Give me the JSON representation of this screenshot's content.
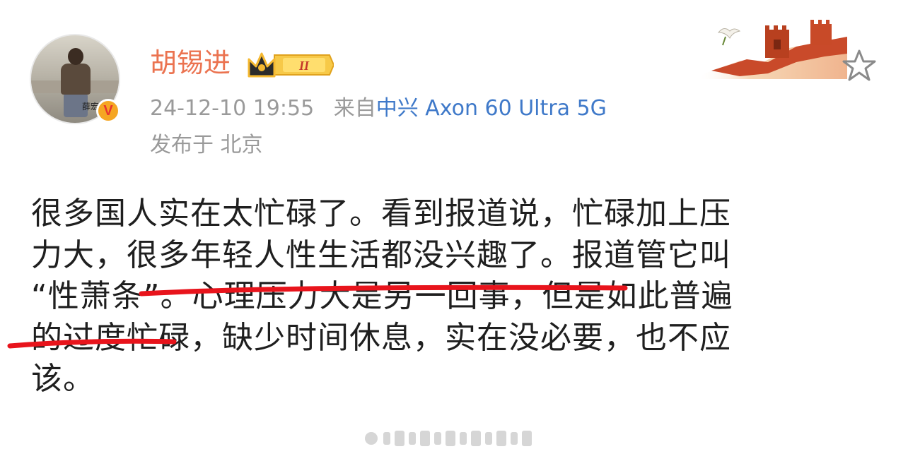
{
  "user": {
    "name": "胡锡进",
    "level_badge": "II",
    "verified_mark": "V",
    "avatar_caption": "薛宏"
  },
  "meta": {
    "timestamp": "24-12-10 19:55",
    "from_label": "来自",
    "device": "中兴 Axon 60 Ultra 5G",
    "location": "发布于 北京"
  },
  "post": {
    "lines": [
      "很多国人实在太忙碌了。看到报道说，忙碌加上压",
      "力大，很多年轻人性生活都没兴趣了。报道管它叫",
      "“性萧条”。心理压力大是另一回事，但是如此普遍",
      "的过度忙碌，缺少时间休息，实在没必要，也不应",
      "该。"
    ]
  },
  "icons": {
    "favorite": "star-icon",
    "decor": "great-wall-decor",
    "badge": "crown-badge"
  },
  "colors": {
    "username": "#eb7350",
    "device_link": "#3f79c9",
    "meta_text": "#9a9a9a",
    "body_text": "#1f1f1f",
    "underline": "#e8141c",
    "verified": "#f5a623"
  }
}
